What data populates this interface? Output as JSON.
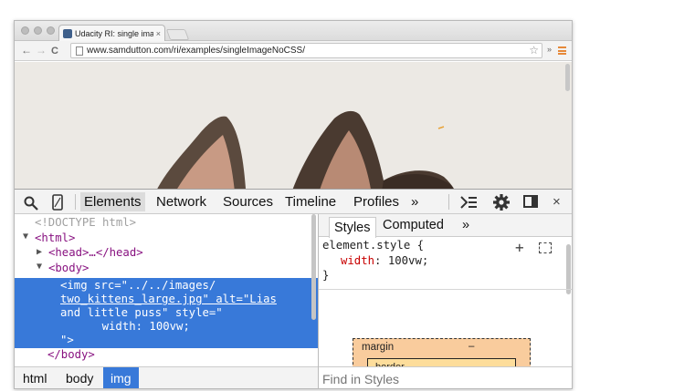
{
  "browser": {
    "tab_title": "Udacity RI: single image, n",
    "tab_close": "×",
    "url": "www.samdutton.com/ri/examples/singleImageNoCSS/",
    "nav": {
      "back": "←",
      "forward": "→",
      "reload": "C"
    },
    "star_icon": "☆",
    "extensions_chevron": "»",
    "menu_color": "#e6893a"
  },
  "devtools": {
    "tabs": [
      "Elements",
      "Network",
      "Sources",
      "Timeline",
      "Profiles"
    ],
    "active_tab": "Elements",
    "more_tabs": "»",
    "close": "×",
    "elements_tree": {
      "doctype": "<!DOCTYPE html>",
      "html_open": "<html>",
      "head": "<head>…</head>",
      "body_open": "<body>",
      "img_lines": [
        "<img src=\"../../images/",
        "two_kittens_large.jpg\" alt=\"Lias",
        "and little puss\" style=\"",
        "    width: 100vw;",
        "\">"
      ],
      "body_close": "</body>"
    },
    "breadcrumbs": [
      "html",
      "body",
      "img"
    ],
    "active_crumb": "img",
    "styles_panel": {
      "tabs": [
        "Styles",
        "Computed"
      ],
      "active_tab": "Styles",
      "more": "»",
      "rule_selector": "element.style {",
      "property": "width",
      "value": "100vw;",
      "rule_close": "}",
      "add_icon": "+",
      "box_model": {
        "margin_label": "margin",
        "margin_value": "–",
        "border_label": "border"
      },
      "find_placeholder": "Find in Styles"
    }
  },
  "colors": {
    "selection": "#3879d9",
    "tag": "#881280",
    "attr_name": "#994500",
    "attr_value": "#1a1aa6",
    "css_property": "#c80000",
    "margin_box": "#f9cc9d"
  }
}
